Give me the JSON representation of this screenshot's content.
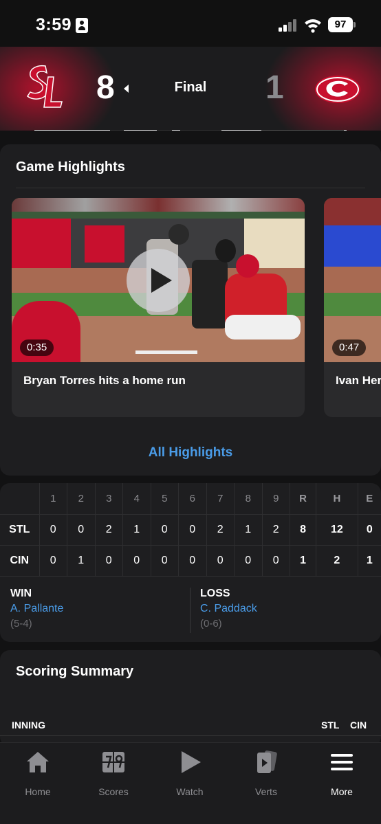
{
  "status_bar": {
    "time": "3:59",
    "battery": "97"
  },
  "game": {
    "away": {
      "abbr": "STL",
      "score": "8"
    },
    "home": {
      "abbr": "CIN",
      "score": "1"
    },
    "status": "Final"
  },
  "highlights": {
    "title": "Game Highlights",
    "videos": [
      {
        "title": "Bryan Torres hits a home run",
        "duration": "0:35"
      },
      {
        "title": "Ivan Her",
        "duration": "0:47"
      }
    ],
    "all_link": "All Highlights"
  },
  "linescore": {
    "headers": [
      "1",
      "2",
      "3",
      "4",
      "5",
      "6",
      "7",
      "8",
      "9",
      "R",
      "H",
      "E"
    ],
    "rows": [
      {
        "team": "STL",
        "values": [
          "0",
          "0",
          "2",
          "1",
          "0",
          "0",
          "2",
          "1",
          "2",
          "8",
          "12",
          "0"
        ]
      },
      {
        "team": "CIN",
        "values": [
          "0",
          "1",
          "0",
          "0",
          "0",
          "0",
          "0",
          "0",
          "0",
          "1",
          "2",
          "1"
        ]
      }
    ]
  },
  "decisions": {
    "win": {
      "label": "WIN",
      "name": "A. Pallante",
      "record": "(5-4)"
    },
    "loss": {
      "label": "LOSS",
      "name": "C. Paddack",
      "record": "(0-6)"
    }
  },
  "scoring_summary": {
    "title": "Scoring Summary",
    "col_inning": "INNING",
    "col_away": "STL",
    "col_home": "CIN"
  },
  "tabs": [
    {
      "label": "Home",
      "icon": "home-icon"
    },
    {
      "label": "Scores",
      "icon": "scores-icon"
    },
    {
      "label": "Watch",
      "icon": "play-icon"
    },
    {
      "label": "Verts",
      "icon": "verts-icon"
    },
    {
      "label": "More",
      "icon": "menu-icon",
      "active": true
    }
  ],
  "colors": {
    "accent_blue": "#4a9ce8",
    "team_red": "#c8102e",
    "background": "#121213",
    "card": "#1e1e20"
  }
}
